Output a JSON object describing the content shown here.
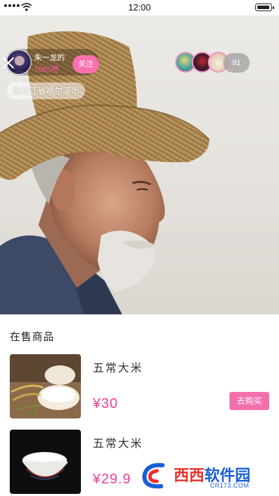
{
  "status_bar": {
    "time": "12:00"
  },
  "live": {
    "host": {
      "name": "朱一龙的",
      "likes": "7865赞",
      "follow_label": "关注"
    },
    "location": "黑龙江省哈尔滨市",
    "viewer_count": "91",
    "icons": {
      "close": "close-icon",
      "avatar": "avatar"
    }
  },
  "products": {
    "title": "在售商品",
    "items": [
      {
        "name": "五常大米",
        "price": "¥30",
        "buy_label": "去购买"
      },
      {
        "name": "五常大米",
        "price": "¥29.9"
      }
    ]
  },
  "watermark": {
    "brand_red": "西西",
    "brand_blue": "软件园",
    "domain": "CR173.COM"
  },
  "colors": {
    "accent": "#ee3f9a",
    "buy_button": "#f26fae",
    "follow_button": "#ff6fb0"
  }
}
